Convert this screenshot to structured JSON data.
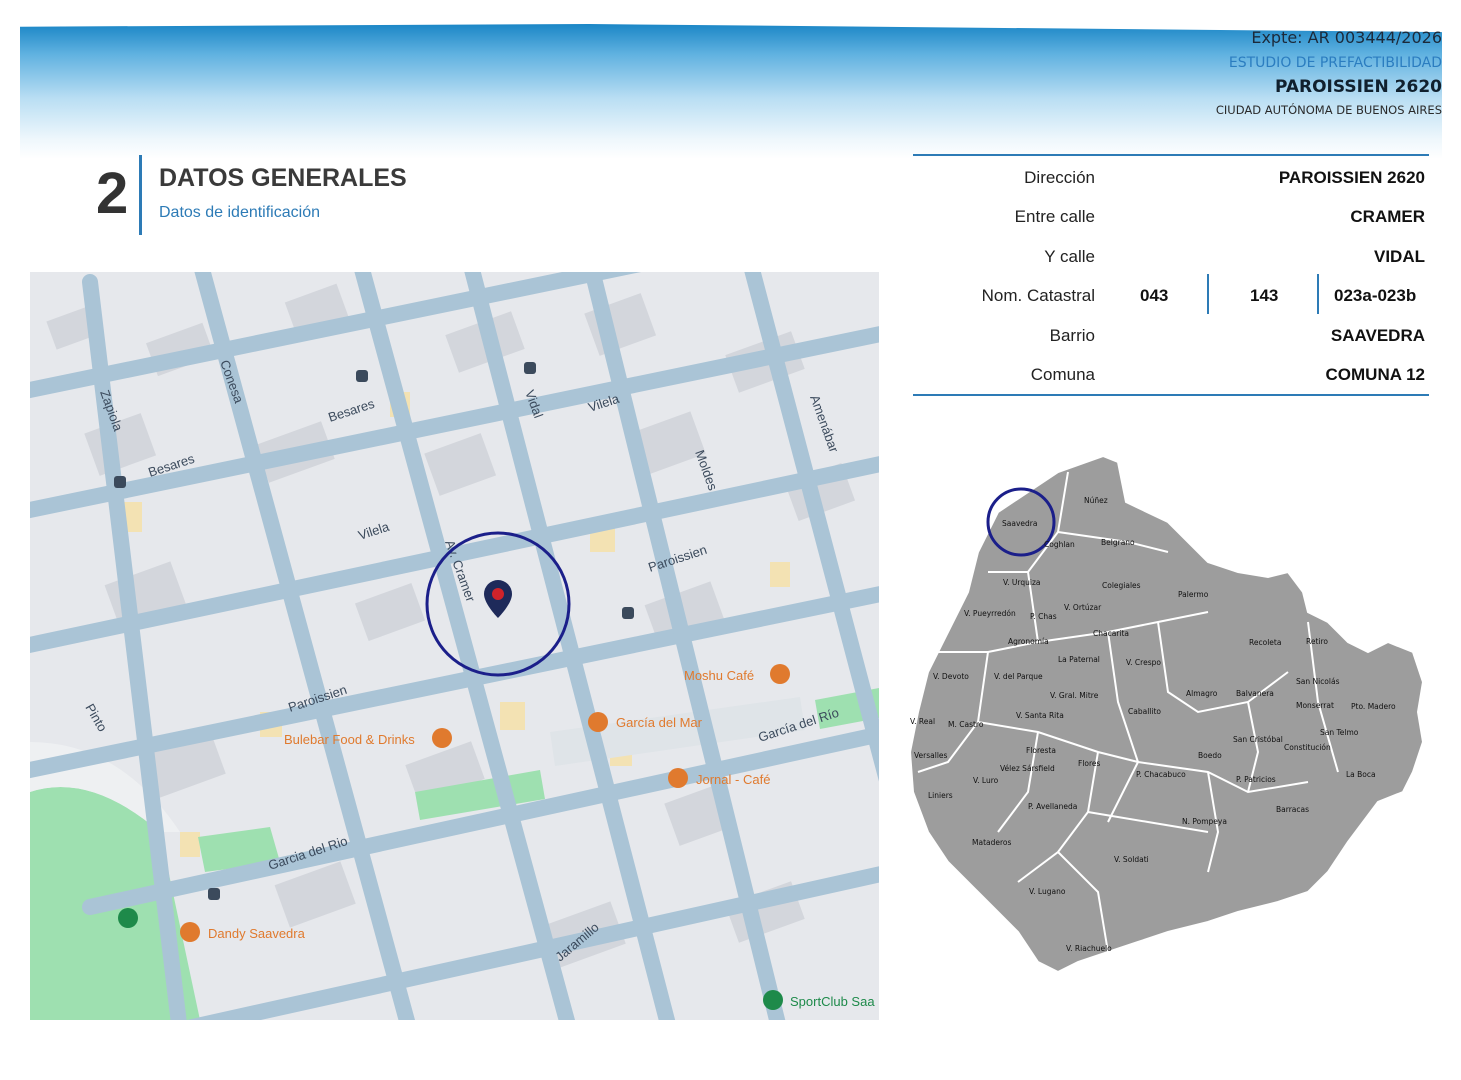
{
  "header": {
    "expediente": "Expte: AR 003444/2026",
    "estudio": "ESTUDIO DE PREFACTIBILIDAD",
    "direccion": "PAROISSIEN 2620",
    "ciudad": "CIUDAD AUTÓNOMA DE BUENOS AIRES"
  },
  "section": {
    "number": "2",
    "title": "DATOS GENERALES",
    "subtitle": "Datos de identificación"
  },
  "info": {
    "direccion": {
      "label": "Dirección",
      "value": "PAROISSIEN 2620"
    },
    "entre_calle": {
      "label": "Entre calle",
      "value": "CRAMER"
    },
    "y_calle": {
      "label": "Y calle",
      "value": "VIDAL"
    },
    "nom_catastral": {
      "label": "Nom. Catastral",
      "seccion": "043",
      "manzana": "143",
      "parcela": "023a-023b"
    },
    "barrio": {
      "label": "Barrio",
      "value": "SAAVEDRA"
    },
    "comuna": {
      "label": "Comuna",
      "value": "COMUNA 12"
    }
  },
  "map": {
    "streets": [
      {
        "name": "Zapiola"
      },
      {
        "name": "Conesa"
      },
      {
        "name": "Vidal"
      },
      {
        "name": "Moldes"
      },
      {
        "name": "Amenábar"
      },
      {
        "name": "Besares"
      },
      {
        "name": "Vilela"
      },
      {
        "name": "Paroissien"
      },
      {
        "name": "Av. Cramer"
      },
      {
        "name": "García del Río"
      },
      {
        "name": "Pinto"
      },
      {
        "name": "Jaramillo"
      },
      {
        "name": "Garcia del Rio"
      }
    ],
    "places": {
      "moshu": "Moshu Café",
      "garcia_mar": "García del Mar",
      "bulebar": "Bulebar Food & Drinks",
      "jornal": "Jornal - Café",
      "dandy": "Dandy Saavedra",
      "sportclub": "SportClub Saa"
    },
    "colors": {
      "road": "#aac4d6",
      "block": "#e6e8ec",
      "building": "#d3d6dc",
      "park": "#9ee0b0",
      "poi": "#e07a2e",
      "pin": "#1e2a5a",
      "circle": "#1b1f8a"
    }
  },
  "barrios": [
    "Saavedra",
    "Núñez",
    "Coghlan",
    "Belgrano",
    "V. Urquiza",
    "Colegiales",
    "Palermo",
    "V. Pueyrredón",
    "P. Chas",
    "V. Ortúzar",
    "Agronomía",
    "Chacarita",
    "Recoleta",
    "Retiro",
    "V. Devoto",
    "V. del Parque",
    "La Paternal",
    "V. Crespo",
    "San Nicolás",
    "V. Gral. Mitre",
    "Almagro",
    "Balvanera",
    "Monserrat",
    "Pto. Madero",
    "V. Real",
    "M. Castro",
    "V. Santa Rita",
    "Caballito",
    "San Cristóbal",
    "San Telmo",
    "Constitución",
    "Versalles",
    "Floresta",
    "Boedo",
    "Vélez Sársfield",
    "Flores",
    "V. Luro",
    "P. Chacabuco",
    "P. Patricios",
    "La Boca",
    "Liniers",
    "P. Avellaneda",
    "N. Pompeya",
    "Barracas",
    "Mataderos",
    "V. Soldati",
    "V. Lugano",
    "V. Riachuelo"
  ]
}
